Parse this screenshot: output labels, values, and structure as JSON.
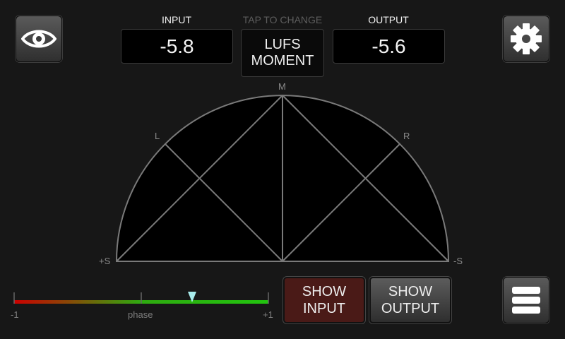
{
  "header": {
    "input_label": "INPUT",
    "tap_hint": "TAP TO CHANGE",
    "output_label": "OUTPUT",
    "input_value": "-5.8",
    "output_value": "-5.6",
    "mode_line1": "LUFS",
    "mode_line2": "MOMENT"
  },
  "scope": {
    "label_m": "M",
    "label_l": "L",
    "label_r": "R",
    "label_plus_s": "+S",
    "label_minus_s": "-S"
  },
  "phase": {
    "label_min": "-1",
    "label_mid": "phase",
    "label_max": "+1",
    "value": 0.4,
    "gradient_colors": [
      "#cc0000",
      "#2faa10",
      "#22c40f"
    ],
    "indicator_color": "#a8ecec"
  },
  "buttons": {
    "show_input_line1": "SHOW",
    "show_input_line2": "INPUT",
    "show_output_line1": "SHOW",
    "show_output_line2": "OUTPUT"
  },
  "icons": {
    "view": "eye-icon",
    "settings": "gear-icon",
    "menu": "menu-icon"
  }
}
